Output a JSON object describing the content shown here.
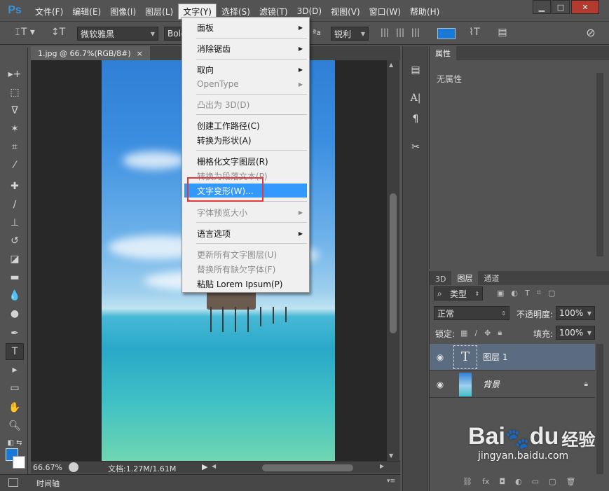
{
  "menubar": {
    "logo": "Ps",
    "items": [
      "文件(F)",
      "编辑(E)",
      "图像(I)",
      "图层(L)",
      "文字(Y)",
      "选择(S)",
      "滤镜(T)",
      "3D(D)",
      "视图(V)",
      "窗口(W)",
      "帮助(H)"
    ],
    "active_index": 4
  },
  "window_controls": {
    "minimize": "▁",
    "maximize": "□",
    "close": "✕"
  },
  "options_bar": {
    "font_family": "微软雅黑",
    "font_style": "Bold",
    "aa_icon": "ªa",
    "anti_alias": "锐利",
    "color": "#1779d8"
  },
  "type_menu": {
    "items": [
      {
        "label": "面板",
        "submenu": true,
        "disabled": false
      },
      {
        "label": "消除锯齿",
        "submenu": true,
        "disabled": false
      },
      {
        "label": "取向",
        "submenu": true,
        "disabled": false
      },
      {
        "label": "OpenType",
        "submenu": true,
        "disabled": true
      },
      {
        "label": "凸出为 3D(D)",
        "submenu": false,
        "disabled": true
      },
      {
        "label": "创建工作路径(C)",
        "submenu": false,
        "disabled": false
      },
      {
        "label": "转换为形状(A)",
        "submenu": false,
        "disabled": false
      },
      {
        "label": "栅格化文字图层(R)",
        "submenu": false,
        "disabled": false
      },
      {
        "label": "转换为段落文本(P)",
        "submenu": false,
        "disabled": true
      },
      {
        "label": "文字变形(W)...",
        "submenu": false,
        "disabled": false,
        "highlighted": true
      },
      {
        "label": "字体预览大小",
        "submenu": true,
        "disabled": true
      },
      {
        "label": "语言选项",
        "submenu": true,
        "disabled": false
      },
      {
        "label": "更新所有文字图层(U)",
        "submenu": false,
        "disabled": true
      },
      {
        "label": "替换所有缺欠字体(F)",
        "submenu": false,
        "disabled": true
      },
      {
        "label": "粘贴 Lorem Ipsum(P)",
        "submenu": false,
        "disabled": false
      }
    ]
  },
  "document": {
    "tab_title": "1.jpg @ 66.7%(RGB/8#)",
    "tab_close": "×",
    "zoom": "66.67%",
    "doc_info": "文档:1.27M/1.61M"
  },
  "timeline": {
    "label": "时间轴"
  },
  "properties_panel": {
    "tab": "属性",
    "empty_text": "无属性"
  },
  "layers_panel": {
    "tabs": [
      "3D",
      "图层",
      "通道"
    ],
    "active_tab": 1,
    "filter_kind": "类型",
    "blend_mode": "正常",
    "opacity_label": "不透明度:",
    "opacity_value": "100%",
    "lock_label": "锁定:",
    "fill_label": "填充:",
    "fill_value": "100%",
    "layers": [
      {
        "name": "图层 1",
        "type": "text",
        "selected": true
      },
      {
        "name": "背景",
        "type": "image",
        "selected": false
      }
    ]
  },
  "watermark": {
    "brand": "Bai",
    "paw": "🐾",
    "brand2": "du",
    "product": "经验",
    "url": "jingyan.baidu.com"
  }
}
